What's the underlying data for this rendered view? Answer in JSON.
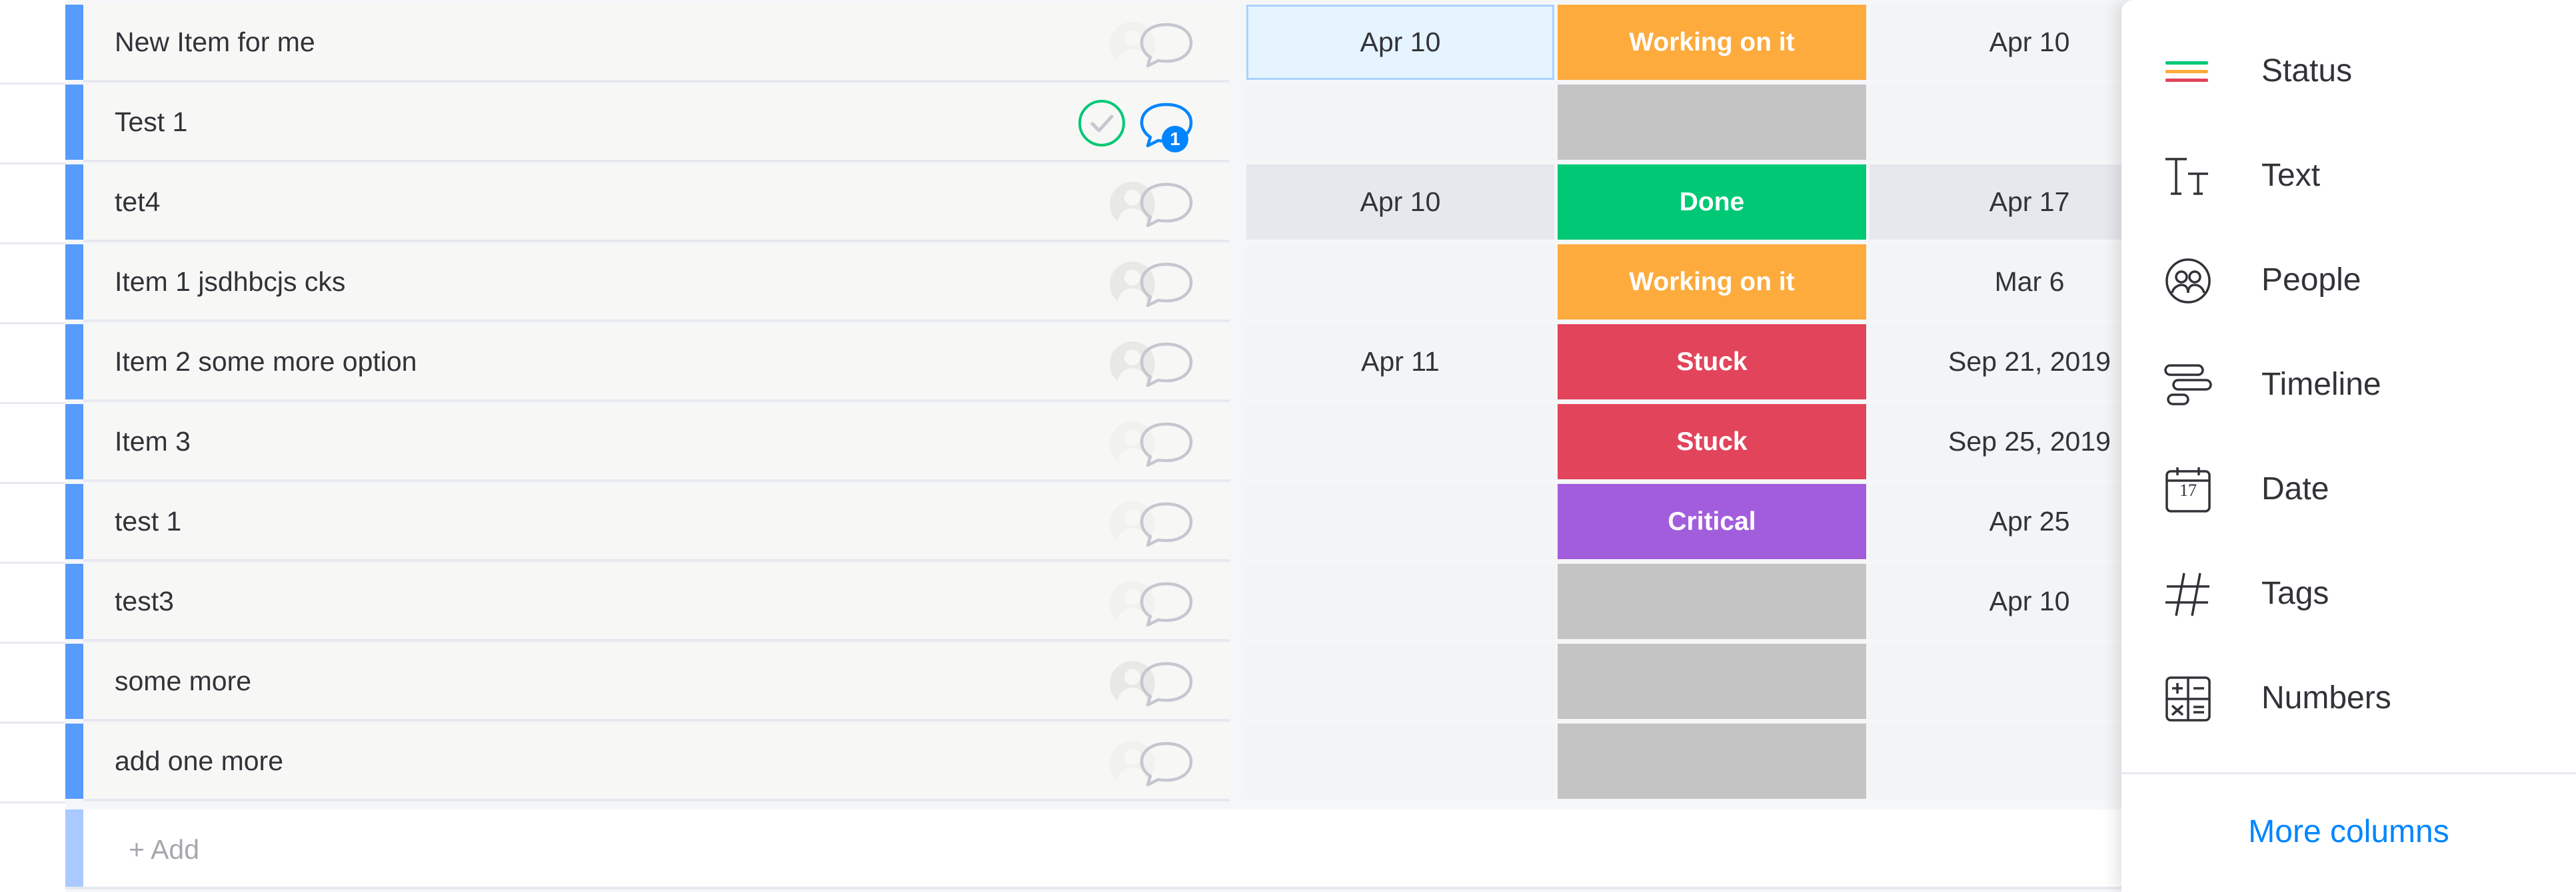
{
  "colors": {
    "group_accent": "#579bfc",
    "status_working": "#fdab3d",
    "status_done": "#00c875",
    "status_stuck": "#e2445c",
    "status_critical": "#a25ddc",
    "status_empty": "#c4c4c4",
    "link_blue": "#0085ff"
  },
  "rows": [
    {
      "name": "New Item for me",
      "date": "Apr 10",
      "status": "Working on it",
      "status_color": "#fdab3d",
      "date2": "Apr 10",
      "updates": null,
      "done_check": false
    },
    {
      "name": "Test 1",
      "date": "",
      "status": "",
      "status_color": "#c4c4c4",
      "date2": "",
      "updates": "1",
      "done_check": true
    },
    {
      "name": "tet4",
      "date": "Apr 10",
      "status": "Done",
      "status_color": "#00c875",
      "date2": "Apr 17",
      "updates": null,
      "done_check": false
    },
    {
      "name": "Item 1 jsdhbcjs cks",
      "date": "",
      "status": "Working on it",
      "status_color": "#fdab3d",
      "date2": "Mar 6",
      "updates": null,
      "done_check": false
    },
    {
      "name": "Item 2 some more option",
      "date": "Apr 11",
      "status": "Stuck",
      "status_color": "#e2445c",
      "date2": "Sep 21, 2019",
      "updates": null,
      "done_check": false
    },
    {
      "name": "Item 3",
      "date": "",
      "status": "Stuck",
      "status_color": "#e2445c",
      "date2": "Sep 25, 2019",
      "updates": null,
      "done_check": false
    },
    {
      "name": "test 1",
      "date": "",
      "status": "Critical",
      "status_color": "#a25ddc",
      "date2": "Apr 25",
      "updates": null,
      "done_check": false
    },
    {
      "name": "test3",
      "date": "",
      "status": "",
      "status_color": "#c4c4c4",
      "date2": "Apr 10",
      "updates": null,
      "done_check": false
    },
    {
      "name": "some more",
      "date": "",
      "status": "",
      "status_color": "#c4c4c4",
      "date2": "",
      "updates": null,
      "done_check": false
    },
    {
      "name": "add one more",
      "date": "",
      "status": "",
      "status_color": "#c4c4c4",
      "date2": "",
      "updates": null,
      "done_check": false
    }
  ],
  "add_row": {
    "label": "+ Add"
  },
  "column_menu": {
    "items": [
      {
        "label": "Status",
        "icon": "status-icon"
      },
      {
        "label": "Text",
        "icon": "text-icon"
      },
      {
        "label": "People",
        "icon": "people-icon"
      },
      {
        "label": "Timeline",
        "icon": "timeline-icon"
      },
      {
        "label": "Date",
        "icon": "date-icon",
        "icon_text": "17"
      },
      {
        "label": "Tags",
        "icon": "tags-icon"
      },
      {
        "label": "Numbers",
        "icon": "numbers-icon"
      }
    ],
    "more_label": "More columns"
  }
}
